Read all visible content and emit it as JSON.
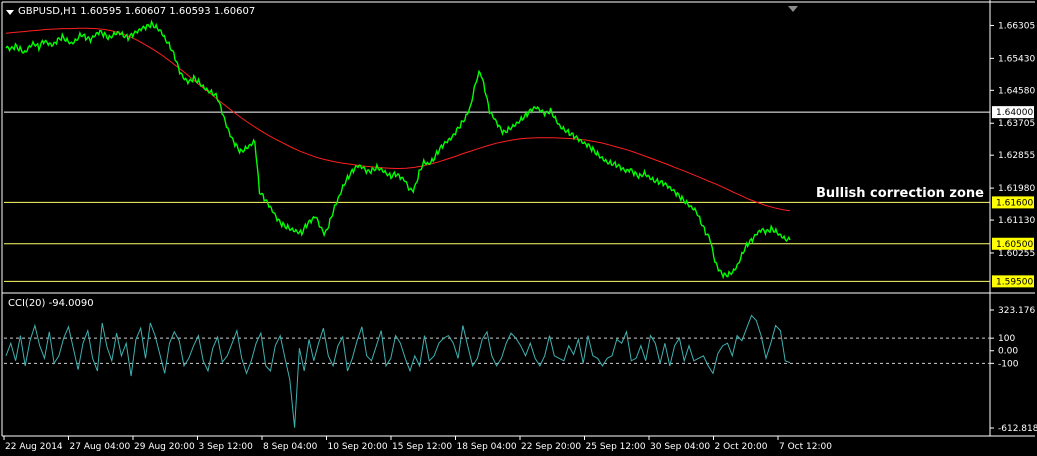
{
  "header": {
    "symbol_text": "GBPUSD,H1  1.60595 1.60607 1.60593 1.60607"
  },
  "cci_label": "CCI(20) -94.0090",
  "annotation": "Bullish correction zone",
  "colors": {
    "price_line": "#00ff00",
    "moving_average": "#ff2020",
    "cci_line": "#40b0b0",
    "level_white": "#ffffff",
    "level_yellow": "#ffff66",
    "badge_yellow": "#ffff00",
    "badge_white": "#ffffff"
  },
  "chart_data": [
    {
      "type": "line",
      "panel": "price",
      "ylim": [
        1.5935,
        1.6645
      ],
      "yticks": [
        "1.66305",
        "1.65430",
        "1.64580",
        "1.63705",
        "1.62855",
        "1.61980",
        "1.61130",
        "1.60255"
      ],
      "levels": [
        {
          "value": 1.64,
          "label": "1.64000",
          "style": "white"
        },
        {
          "value": 1.616,
          "label": "1.61600",
          "style": "yellow"
        },
        {
          "value": 1.605,
          "label": "1.60500",
          "style": "yellow"
        },
        {
          "value": 1.595,
          "label": "1.59500",
          "style": "yellow"
        }
      ],
      "xticks": [
        "22 Aug 2014",
        "27 Aug 04:00",
        "29 Aug 20:00",
        "3 Sep 12:00",
        "8 Sep 04:00",
        "10 Sep 20:00",
        "15 Sep 12:00",
        "18 Sep 04:00",
        "22 Sep 20:00",
        "25 Sep 12:00",
        "30 Sep 04:00",
        "2 Oct 20:00",
        "7 Oct 12:00"
      ],
      "series": [
        {
          "values": [
            1.657,
            1.6565,
            1.6575,
            1.6568,
            1.656,
            1.6578,
            1.6585,
            1.6572,
            1.6588,
            1.658,
            1.6575,
            1.659,
            1.66,
            1.6592,
            1.6585,
            1.6595,
            1.6608,
            1.6598,
            1.659,
            1.6602,
            1.6612,
            1.6605,
            1.6598,
            1.661,
            1.6615,
            1.6606,
            1.6598,
            1.6605,
            1.6612,
            1.662,
            1.6626,
            1.6634,
            1.6628,
            1.6618,
            1.6595,
            1.6575,
            1.6545,
            1.6505,
            1.6485,
            1.6478,
            1.649,
            1.6482,
            1.647,
            1.646,
            1.6452,
            1.644,
            1.64,
            1.636,
            1.633,
            1.631,
            1.6295,
            1.6305,
            1.6315,
            1.6325,
            1.619,
            1.617,
            1.615,
            1.613,
            1.611,
            1.61,
            1.6095,
            1.609,
            1.6085,
            1.608,
            1.61,
            1.611,
            1.612,
            1.609,
            1.6075,
            1.611,
            1.615,
            1.618,
            1.621,
            1.623,
            1.6245,
            1.6255,
            1.625,
            1.624,
            1.6245,
            1.6255,
            1.625,
            1.624,
            1.623,
            1.6235,
            1.6225,
            1.6215,
            1.619,
            1.6195,
            1.624,
            1.627,
            1.6265,
            1.6275,
            1.6295,
            1.631,
            1.632,
            1.633,
            1.635,
            1.637,
            1.639,
            1.642,
            1.648,
            1.651,
            1.646,
            1.64,
            1.638,
            1.636,
            1.6345,
            1.6355,
            1.6365,
            1.6375,
            1.6385,
            1.6395,
            1.6405,
            1.641,
            1.64,
            1.6395,
            1.6405,
            1.6385,
            1.6365,
            1.6355,
            1.6345,
            1.6335,
            1.6325,
            1.6315,
            1.631,
            1.63,
            1.629,
            1.628,
            1.627,
            1.6265,
            1.626,
            1.625,
            1.624,
            1.6245,
            1.6235,
            1.623,
            1.624,
            1.623,
            1.622,
            1.6215,
            1.621,
            1.62,
            1.619,
            1.618,
            1.617,
            1.616,
            1.615,
            1.614,
            1.611,
            1.608,
            1.606,
            1.6,
            1.5975,
            1.5965,
            1.597,
            1.598,
            1.6,
            1.603,
            1.605,
            1.606,
            1.6075,
            1.6085,
            1.608,
            1.609,
            1.6085,
            1.6075,
            1.6065,
            1.606
          ]
        },
        {
          "name": "",
          "values": [
            1.661,
            1.6612,
            1.6614,
            1.6616,
            1.6618,
            1.662,
            1.6621,
            1.6622,
            1.6622,
            1.6623,
            1.6623,
            1.6622,
            1.662,
            1.6616,
            1.661,
            1.6602,
            1.6592,
            1.658,
            1.6567,
            1.6553,
            1.6537,
            1.652,
            1.6503,
            1.6485,
            1.6467,
            1.645,
            1.6432,
            1.6415,
            1.6398,
            1.6382,
            1.6367,
            1.6353,
            1.634,
            1.6328,
            1.6317,
            1.6306,
            1.6296,
            1.6288,
            1.628,
            1.6274,
            1.6269,
            1.6265,
            1.6262,
            1.6259,
            1.6256,
            1.6254,
            1.6252,
            1.6251,
            1.625,
            1.6251,
            1.6253,
            1.6257,
            1.6262,
            1.6268,
            1.6275,
            1.6282,
            1.629,
            1.6297,
            1.6304,
            1.6311,
            1.6317,
            1.6322,
            1.6326,
            1.6329,
            1.6331,
            1.6332,
            1.6332,
            1.6332,
            1.6331,
            1.633,
            1.6328,
            1.6326,
            1.6322,
            1.6318,
            1.6312,
            1.6306,
            1.63,
            1.6293,
            1.6285,
            1.6277,
            1.6269,
            1.6261,
            1.6252,
            1.6244,
            1.6235,
            1.6226,
            1.6217,
            1.6208,
            1.6198,
            1.6188,
            1.6178,
            1.6168,
            1.616,
            1.6152,
            1.6146,
            1.6141,
            1.6138
          ]
        }
      ]
    },
    {
      "type": "line",
      "panel": "cci",
      "title": "CCI(20) -94.0090",
      "ylim": [
        -612.8183,
        323.176
      ],
      "yticks": [
        "323.176",
        "100",
        "0.00",
        "-100",
        "-612.8183"
      ],
      "levels": [
        {
          "value": 100,
          "style": "dashed"
        },
        {
          "value": -100,
          "style": "dashed"
        }
      ],
      "series": [
        {
          "values": [
            -40,
            60,
            -80,
            120,
            -120,
            80,
            200,
            40,
            -60,
            150,
            -100,
            -40,
            100,
            190,
            20,
            -150,
            60,
            160,
            -60,
            -160,
            220,
            30,
            -80,
            140,
            -40,
            60,
            -200,
            90,
            180,
            -60,
            220,
            120,
            -30,
            -180,
            60,
            150,
            80,
            -120,
            -60,
            40,
            120,
            -80,
            -160,
            20,
            110,
            -90,
            -40,
            60,
            160,
            -60,
            -180,
            -80,
            60,
            140,
            -120,
            -160,
            40,
            120,
            -60,
            -230,
            -610,
            20,
            -160,
            90,
            -80,
            60,
            180,
            -40,
            -120,
            40,
            110,
            -160,
            -60,
            80,
            190,
            -40,
            -80,
            40,
            160,
            -120,
            -60,
            120,
            60,
            -60,
            -160,
            -40,
            -120,
            120,
            -80,
            -40,
            60,
            100,
            120,
            60,
            -60,
            200,
            40,
            -120,
            -60,
            90,
            150,
            -40,
            -120,
            -60,
            60,
            140,
            100,
            40,
            -40,
            60,
            -60,
            -120,
            -40,
            120,
            -40,
            -60,
            -80,
            40,
            -30,
            90,
            -100,
            120,
            -40,
            -60,
            -120,
            -60,
            -40,
            90,
            60,
            150,
            -80,
            -60,
            40,
            -80,
            120,
            60,
            -100,
            60,
            -120,
            40,
            100,
            -80,
            40,
            -80,
            -60,
            -40,
            -120,
            -180,
            -20,
            40,
            60,
            -40,
            120,
            80,
            180,
            280,
            240,
            120,
            -60,
            60,
            200,
            160,
            -80,
            -94
          ]
        }
      ]
    }
  ]
}
